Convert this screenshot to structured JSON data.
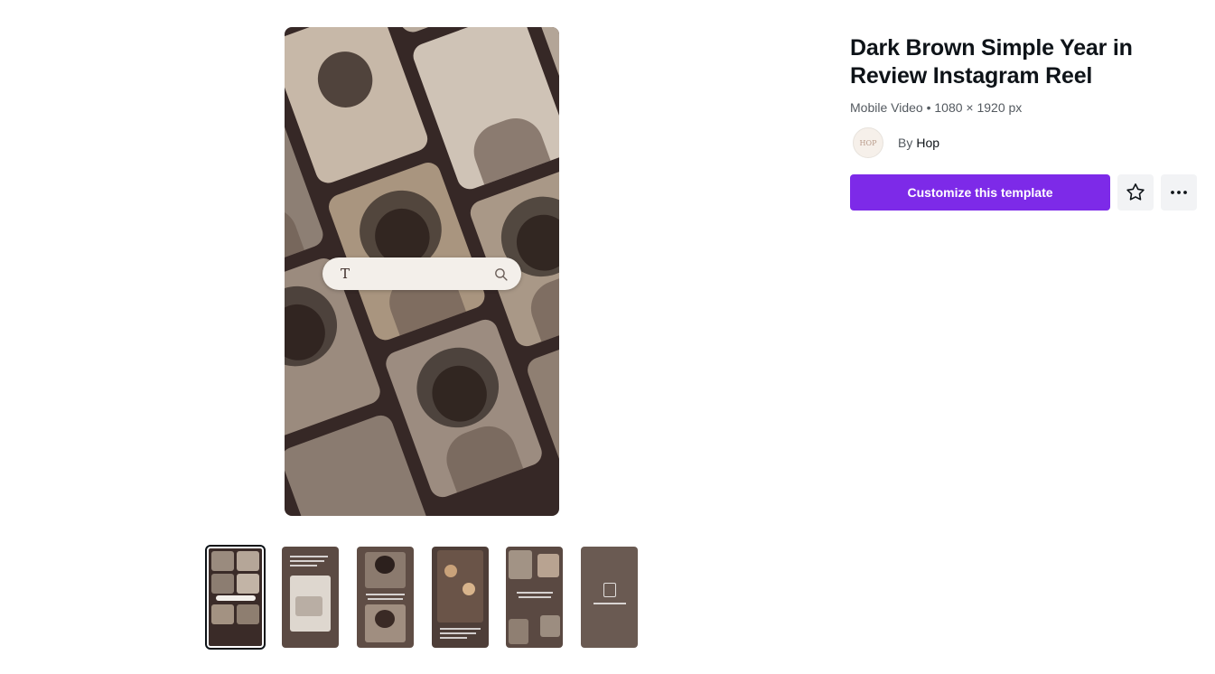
{
  "template": {
    "title": "Dark Brown Simple Year in Review Instagram Reel",
    "meta": "Mobile Video • 1080 × 1920 px",
    "by_label": "By",
    "author": "Hop",
    "avatar_text": "HOP"
  },
  "actions": {
    "customize_label": "Customize this template",
    "favorite_icon": "star-icon",
    "more_icon": "more-horizontal-icon"
  },
  "preview": {
    "search_text": "T",
    "search_icon": "search-icon"
  },
  "thumbnails": {
    "count": 6,
    "selected_index": 0
  },
  "colors": {
    "accent": "#7d2ae8",
    "preview_background": "#362826",
    "thumb_background": "#5c4a43"
  }
}
